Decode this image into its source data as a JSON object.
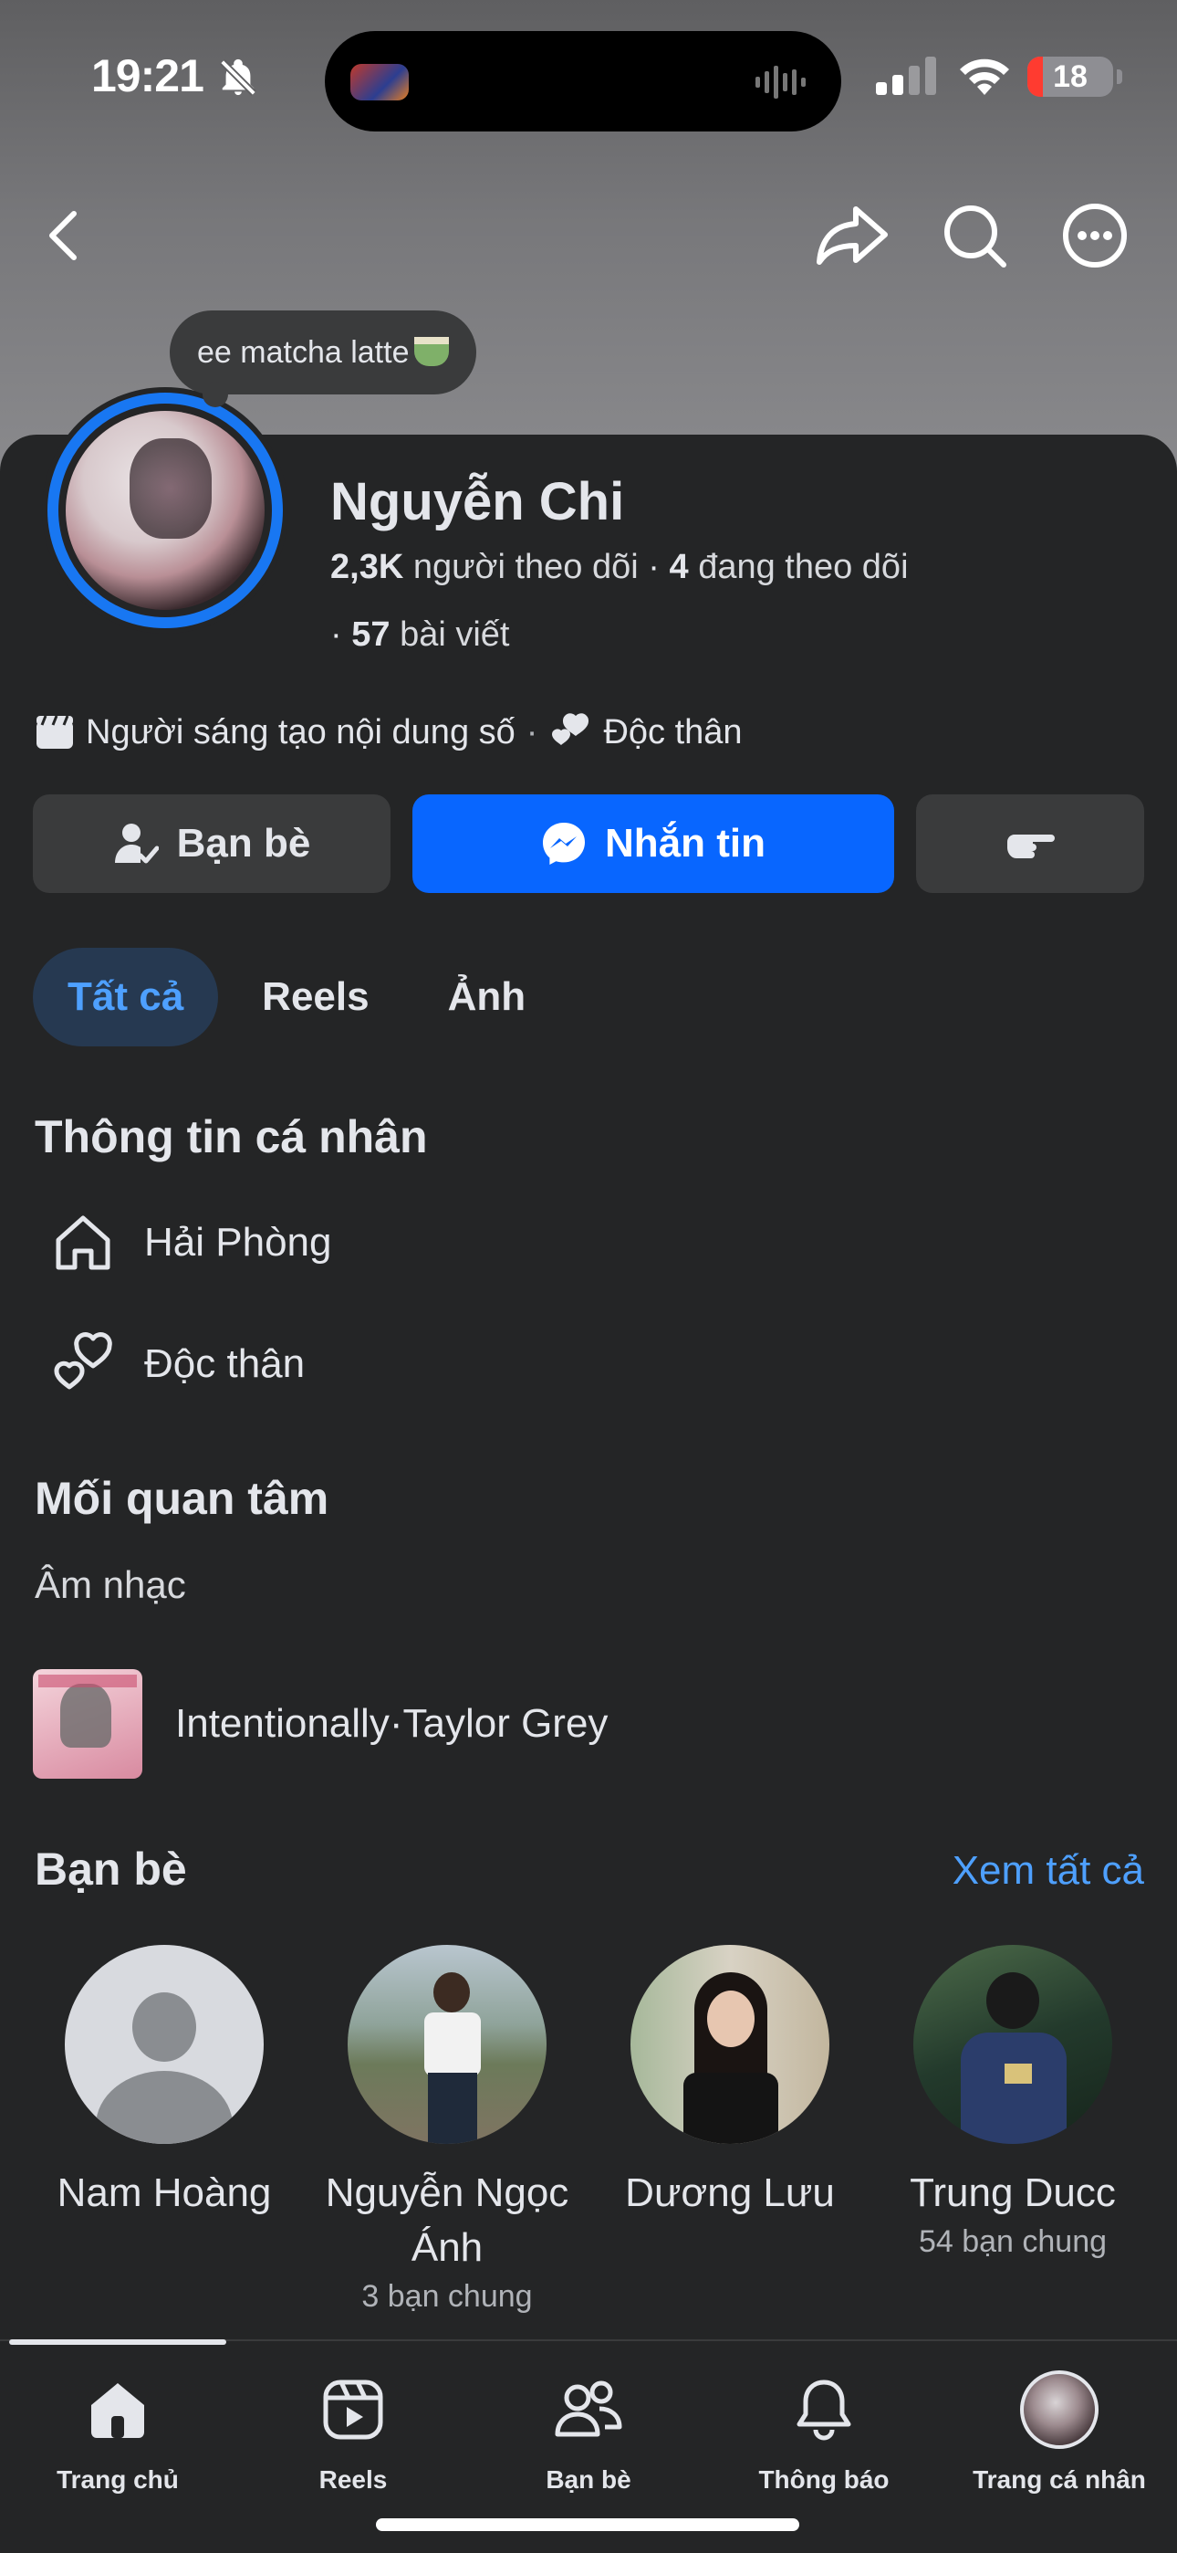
{
  "status_bar": {
    "time": "19:21",
    "battery_level": "18",
    "battery_fraction": 0.18
  },
  "top_nav": {
    "back_icon": "chevron-left-icon",
    "share_icon": "share-icon",
    "search_icon": "search-icon",
    "more_icon": "more-icon"
  },
  "profile": {
    "note": "ee matcha latte",
    "name": "Nguyễn Chi",
    "followers_count": "2,3K",
    "followers_label": "người theo dõi",
    "following_count": "4",
    "following_label": "đang theo dõi",
    "posts_count": "57",
    "posts_label": "bài viết",
    "bio_category": "Người sáng tạo nội dung số",
    "bio_relationship": "Độc thân"
  },
  "actions": {
    "friends_label": "Bạn bè",
    "message_label": "Nhắn tin",
    "poke_icon": "poke-icon"
  },
  "tabs": [
    {
      "label": "Tất cả",
      "active": true
    },
    {
      "label": "Reels",
      "active": false
    },
    {
      "label": "Ảnh",
      "active": false
    }
  ],
  "personal_info": {
    "title": "Thông tin cá nhân",
    "items": [
      {
        "icon": "home-icon",
        "text": "Hải Phòng"
      },
      {
        "icon": "hearts-icon",
        "text": "Độc thân"
      }
    ]
  },
  "interests": {
    "title": "Mối quan tâm",
    "category": "Âm nhạc",
    "music": "Intentionally·Taylor Grey"
  },
  "friends": {
    "title": "Bạn bè",
    "see_all": "Xem tất cả",
    "list": [
      {
        "name": "Nam Hoàng",
        "mutual": ""
      },
      {
        "name": "Nguyễn Ngọc Ánh",
        "mutual": "3 bạn chung"
      },
      {
        "name": "Dương Lưu",
        "mutual": ""
      },
      {
        "name": "Trung Ducc",
        "mutual": "54 bạn chung"
      }
    ]
  },
  "bottom_nav": [
    {
      "label": "Trang chủ",
      "icon": "home-icon",
      "active": true
    },
    {
      "label": "Reels",
      "icon": "reels-icon",
      "active": false
    },
    {
      "label": "Bạn bè",
      "icon": "friends-icon",
      "active": false
    },
    {
      "label": "Thông báo",
      "icon": "bell-icon",
      "active": false
    },
    {
      "label": "Trang cá nhân",
      "icon": "profile-avatar",
      "active": false
    }
  ],
  "colors": {
    "accent": "#0866ff",
    "link": "#4ea0ff",
    "background": "#242526",
    "surface": "#3a3b3c",
    "battery_low": "#ff3b30"
  }
}
